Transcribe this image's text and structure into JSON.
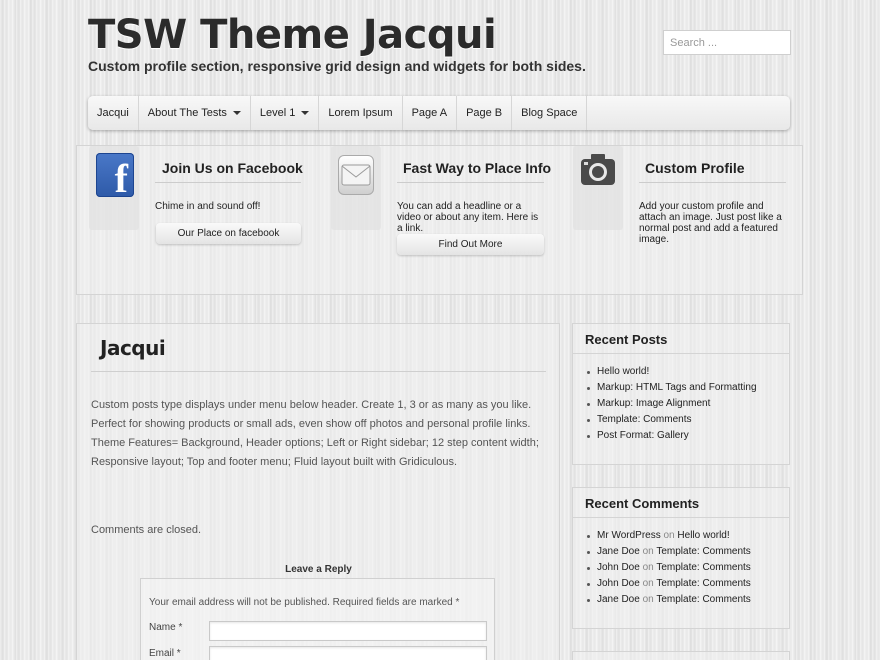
{
  "header": {
    "site_title": "TSW Theme Jacqui",
    "tagline": "Custom profile section, responsive grid design and widgets for both sides.",
    "search_placeholder": "Search ..."
  },
  "nav": {
    "items": [
      {
        "label": "Jacqui",
        "has_dropdown": false
      },
      {
        "label": "About The Tests",
        "has_dropdown": true
      },
      {
        "label": "Level 1",
        "has_dropdown": true
      },
      {
        "label": "Lorem Ipsum",
        "has_dropdown": false
      },
      {
        "label": "Page A",
        "has_dropdown": false
      },
      {
        "label": "Page B",
        "has_dropdown": false
      },
      {
        "label": "Blog Space",
        "has_dropdown": false
      }
    ]
  },
  "features": [
    {
      "icon": "facebook-icon",
      "title": "Join Us on Facebook",
      "text": "Chime in and sound off!",
      "button": "Our Place on facebook"
    },
    {
      "icon": "envelope-icon",
      "title": "Fast Way to Place Info",
      "text": "You can add a headline or a video or about any item. Here is a link.",
      "button": "Find Out More"
    },
    {
      "icon": "camera-icon",
      "title": "Custom Profile",
      "text": "Add your custom profile and attach an image. Just post like a normal post and add a featured image.",
      "button": ""
    }
  ],
  "post": {
    "title": "Jacqui",
    "body": "Custom posts type displays under menu below header. Create 1, 3 or as many as you like. Perfect for showing products or small ads, even show off photos and personal profile links. Theme Features= Background, Header options; Left or Right sidebar; 12 step content width; Responsive layout; Top and footer menu; Fluid layout built with Gridiculous.",
    "comments_closed": "Comments are closed.",
    "reply_title": "Leave a Reply",
    "reply_note": "Your email address will not be published. Required fields are marked *",
    "name_label": "Name *",
    "email_label": "Email *"
  },
  "sidebar": {
    "recent_posts": {
      "title": "Recent Posts",
      "items": [
        "Hello world!",
        "Markup: HTML Tags and Formatting",
        "Markup: Image Alignment",
        "Template: Comments",
        "Post Format: Gallery"
      ]
    },
    "recent_comments": {
      "title": "Recent Comments",
      "connector": "on",
      "items": [
        {
          "author": "Mr WordPress",
          "post": "Hello world!"
        },
        {
          "author": "Jane Doe",
          "post": "Template: Comments"
        },
        {
          "author": "John Doe",
          "post": "Template: Comments"
        },
        {
          "author": "John Doe",
          "post": "Template: Comments"
        },
        {
          "author": "Jane Doe",
          "post": "Template: Comments"
        }
      ]
    }
  }
}
